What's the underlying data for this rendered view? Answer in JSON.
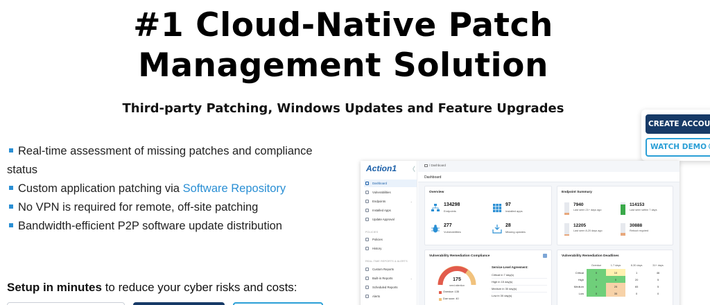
{
  "hero": {
    "title_line1": "#1 Cloud-Native Patch",
    "title_line2": "Management Solution",
    "subtitle": "Third-party Patching, Windows Updates and Feature Upgrades"
  },
  "features": {
    "f1_a": "Real-time assessment of missing patches and compliance",
    "f1_b": "status",
    "f2_text": "Custom application patching via ",
    "f2_link": "Software Repository",
    "f3": "No VPN is required for remote, off-site patching",
    "f4": "Bandwidth-efficient P2P software update distribution"
  },
  "setup": {
    "bold": "Setup in minutes",
    "rest": " to reduce your cyber risks and costs:"
  },
  "cta": {
    "create_account": "CREATE ACCOUNT",
    "watch_demo": "WATCH DEMO"
  },
  "colors": {
    "brand_navy": "#173a67",
    "accent_blue": "#2a9fd6",
    "link_blue": "#2a8fd4"
  },
  "app": {
    "logo": "Action1",
    "breadcrumb": "Dashboard",
    "page_title": "Dashboard",
    "nav": {
      "dashboard": "Dashboard",
      "vulnerabilities": "Vulnerabilities",
      "endpoints": "Endpoints",
      "installed_apps": "Installed Apps",
      "update_approval": "Update Approval",
      "section_policies": "POLICIES",
      "policies": "Policies",
      "history": "History",
      "section_reports": "REAL-TIME REPORTS & ALERTS",
      "custom_reports": "Custom Reports",
      "built_in_reports": "Built-in Reports",
      "scheduled_reports": "Scheduled Reports",
      "alerts": "Alerts"
    },
    "overview": {
      "title": "Overview",
      "endpoints_num": "134298",
      "endpoints_lbl": "Endpoints",
      "apps_num": "97",
      "apps_lbl": "Installed apps",
      "vulns_num": "277",
      "vulns_lbl": "Vulnerabilities",
      "updates_num": "28",
      "updates_lbl": "Missing updates"
    },
    "endpoint_summary": {
      "title": "Endpoint Summary",
      "a_num": "7940",
      "a_lbl": "Last seen 21+ days ago",
      "b_num": "114153",
      "b_lbl": "Last seen within 7 days",
      "c_num": "12205",
      "c_lbl": "Last seen 8-20 days ago",
      "d_num": "30888",
      "d_lbl": "Reboot required"
    },
    "compliance": {
      "title": "Vulnerability Remediation Compliance",
      "gauge_num": "175",
      "gauge_lbl": "need attention",
      "overdue": "Overdue: 135",
      "due_soon": "Due soon: 40",
      "sla_title": "Service-Level Agreement:",
      "sla_critical": "Critical in 7 day(s)",
      "sla_high": "High in 15 day(s)",
      "sla_medium": "Medium in 30 day(s)",
      "sla_low": "Low in 30 day(s)"
    },
    "deadlines": {
      "title": "Vulnerability Remediation Deadlines",
      "headers": [
        "Overdue",
        "1-7 days",
        "8-30 days",
        "31+ days"
      ],
      "rows": [
        {
          "label": "Critical",
          "v": [
            "0",
            "10",
            "1",
            "46"
          ]
        },
        {
          "label": "High",
          "v": [
            "0",
            "0",
            "20",
            "5"
          ]
        },
        {
          "label": "Medium",
          "v": [
            "0",
            "25",
            "65",
            "5"
          ]
        },
        {
          "label": "Low",
          "v": [
            "0",
            "35",
            "0",
            "0"
          ]
        }
      ]
    }
  }
}
